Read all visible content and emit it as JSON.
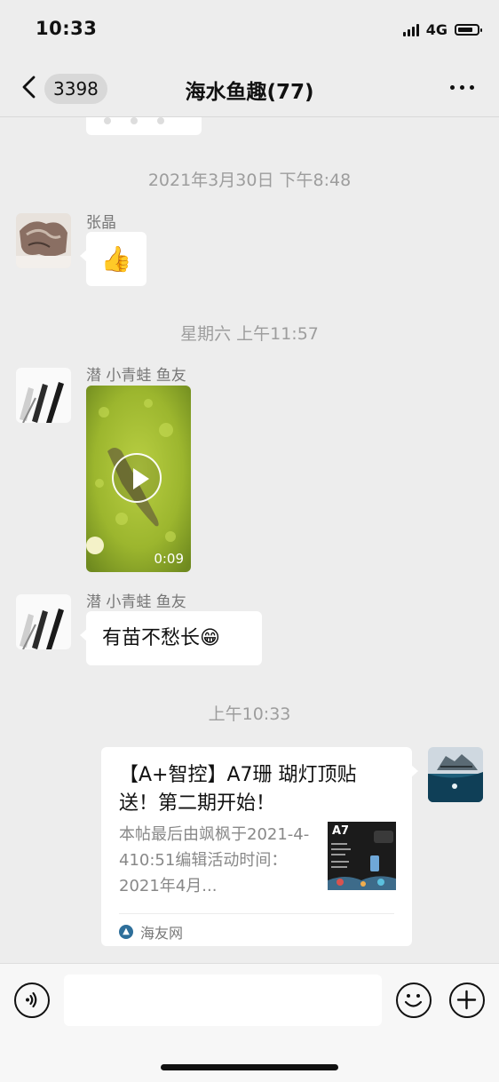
{
  "status_bar": {
    "time": "10:33",
    "network": "4G"
  },
  "nav": {
    "back_count": "3398",
    "title": "海水鱼趣(77)"
  },
  "chat": {
    "timestamps": [
      "2021年3月30日 下午8:48",
      "星期六 上午11:57",
      "上午10:33"
    ],
    "messages": [
      {
        "sender": "张晶",
        "content": "👍"
      },
      {
        "sender": "潜 小青蛙 鱼友",
        "video_duration": "0:09"
      },
      {
        "sender": "潜 小青蛙 鱼友",
        "content": "有苗不愁长😁"
      }
    ],
    "link_card": {
      "title": "【A+智控】A7珊 瑚灯顶贴送！第二期开始！",
      "description": "本帖最后由飒枫于2021-4-410:51编辑活动时间：2021年4月...",
      "thumbnail_label": "A7",
      "source": "海友网"
    }
  },
  "input_bar": {
    "voice_icon": "voice-icon",
    "emoji_icon": "emoji-icon",
    "add_icon": "plus-icon"
  }
}
